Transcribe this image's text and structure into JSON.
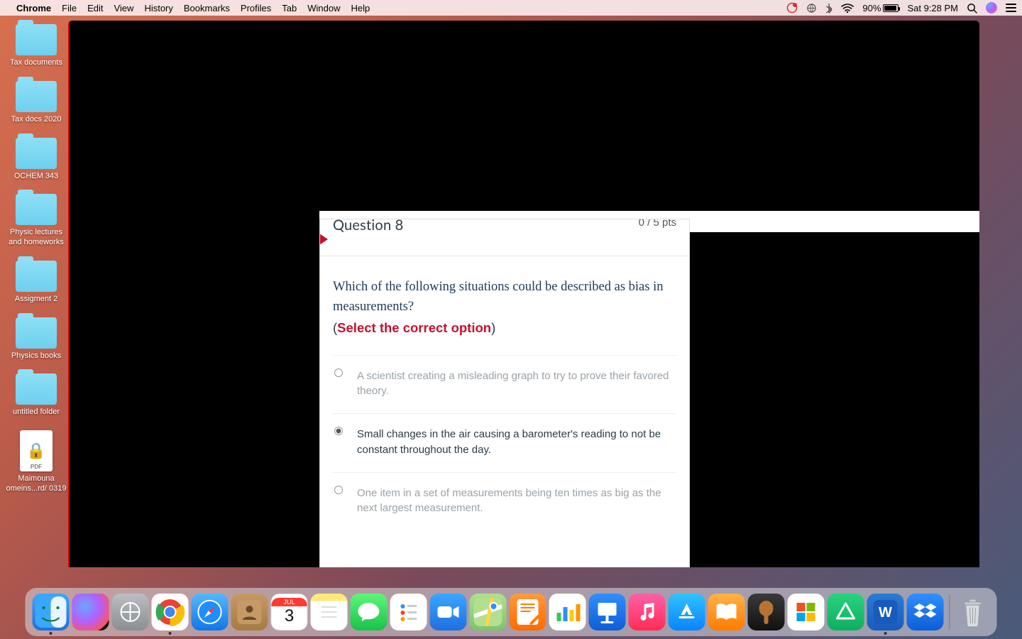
{
  "menubar": {
    "app": "Chrome",
    "items": [
      "File",
      "Edit",
      "View",
      "History",
      "Bookmarks",
      "Profiles",
      "Tab",
      "Window",
      "Help"
    ],
    "battery_pct": "90%",
    "clock": "Sat 9:28 PM"
  },
  "desktop": {
    "folders": [
      "Tax documents",
      "Tax docs 2020",
      "OCHEM 343",
      "Physic lectures and homeworks",
      "Assigment 2",
      "Physics books",
      "untitled folder"
    ],
    "pdf": {
      "label": "Maimouna omeins...rd/ 0319",
      "tag": "PDF"
    }
  },
  "quiz": {
    "header_title": "Question 8",
    "header_pts": "0 / 5 pts",
    "prompt": "Which of the following situations could be described as bias in measurements?",
    "hint_open": "(",
    "hint_red": "Select the correct option",
    "hint_close": ")",
    "options": [
      {
        "text": "A scientist creating a misleading graph to try to prove their favored theory.",
        "selected": false,
        "dim": true
      },
      {
        "text": "Small changes in the air causing a barometer's reading to not be constant throughout the day.",
        "selected": true,
        "dim": false
      },
      {
        "text": "One item in a set of measurements being ten times as big as the next largest measurement.",
        "selected": false,
        "dim": true
      }
    ]
  },
  "dock": {
    "cal_month": "JUL",
    "cal_day": "3"
  }
}
